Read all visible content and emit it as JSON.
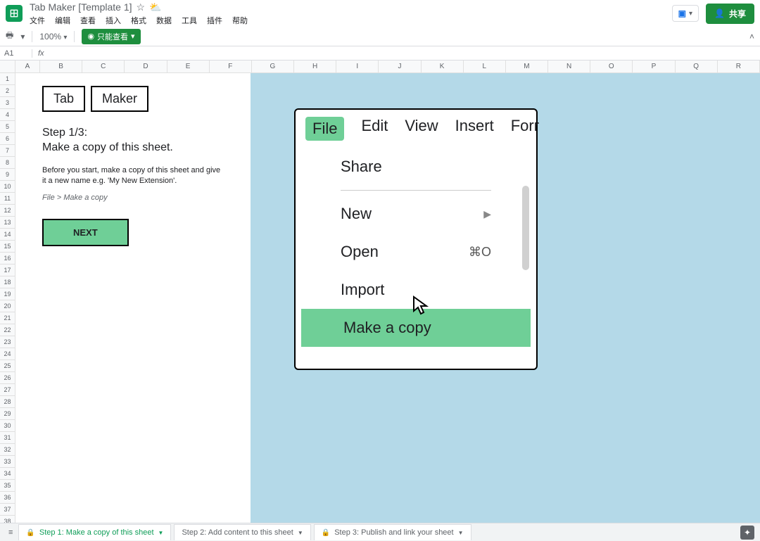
{
  "header": {
    "title": "Tab Maker [Template 1]",
    "menus": [
      "文件",
      "编辑",
      "查看",
      "插入",
      "格式",
      "数据",
      "工具",
      "插件",
      "帮助"
    ],
    "share_label": "共享"
  },
  "toolbar": {
    "zoom": "100%",
    "view_only": "只能查看"
  },
  "formula_bar": {
    "name_box": "A1",
    "fx": "fx"
  },
  "columns": [
    "A",
    "B",
    "C",
    "D",
    "E",
    "F",
    "G",
    "H",
    "I",
    "J",
    "K",
    "L",
    "M",
    "N",
    "O",
    "P",
    "Q",
    "R"
  ],
  "rows": [
    "1",
    "2",
    "3",
    "4",
    "5",
    "6",
    "7",
    "8",
    "9",
    "10",
    "11",
    "12",
    "13",
    "14",
    "15",
    "16",
    "17",
    "18",
    "19",
    "20",
    "21",
    "22",
    "23",
    "24",
    "25",
    "26",
    "27",
    "28",
    "29",
    "30",
    "31",
    "32",
    "33",
    "34",
    "35",
    "36",
    "37",
    "38"
  ],
  "content": {
    "logo_word1": "Tab",
    "logo_word2": "Maker",
    "step_heading_l1": "Step 1/3:",
    "step_heading_l2": "Make a copy of this sheet.",
    "desc": "Before you start, make a copy of this sheet and give it a new name e.g. 'My New Extension'.",
    "path": "File > Make a copy",
    "next": "NEXT"
  },
  "illustration": {
    "menubar": [
      "File",
      "Edit",
      "View",
      "Insert",
      "Forr"
    ],
    "items": {
      "share": "Share",
      "new": "New",
      "open": "Open",
      "open_shortcut": "⌘O",
      "import": "Import",
      "make_copy": "Make a copy"
    }
  },
  "sheet_tabs": {
    "tab1": "Step 1: Make a copy of this sheet",
    "tab2": "Step 2: Add content to this sheet",
    "tab3": "Step 3: Publish and link your sheet"
  }
}
